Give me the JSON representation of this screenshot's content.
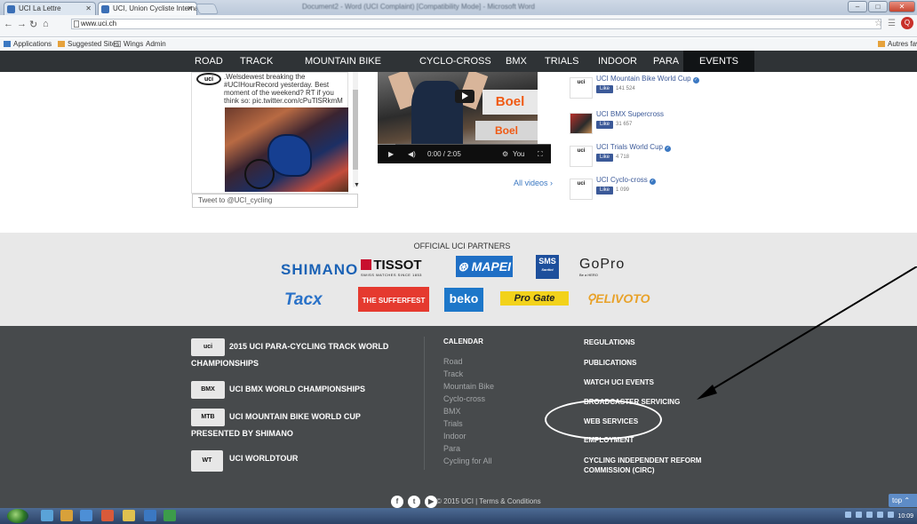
{
  "browser": {
    "tabs": [
      {
        "title": "UCI La Lettre"
      },
      {
        "title": "UCI, Union Cycliste Internationale"
      }
    ],
    "window_title": "Document2 - Word (UCI Complaint) [Compatibility Mode] - Microsoft Word",
    "url": "www.uci.ch",
    "bookmarks": [
      {
        "label": "Applications",
        "color": "#3b78c2"
      },
      {
        "label": "Suggested Sites",
        "color": "#e6a23c"
      },
      {
        "label": "Wings",
        "color": "#888888"
      },
      {
        "label": "Admin",
        "color": "#888888"
      }
    ],
    "autres_favoris": "Autres fav"
  },
  "nav": {
    "items": [
      "ROAD",
      "TRACK",
      "MOUNTAIN BIKE",
      "CYCLO-CROSS",
      "BMX",
      "TRIALS",
      "INDOOR",
      "PARA",
      "EVENTS"
    ],
    "active": "EVENTS"
  },
  "tweet": {
    "logo": "uci",
    "text": ".Welsdewest breaking the #UCIHourRecord yesterday. Best moment of the weekend? RT if you think so: pic.twitter.com/cPuTlSRkmM",
    "input_placeholder": "Tweet to @UCI_cycling"
  },
  "video": {
    "time": "0:00 / 2:05",
    "banner": "Boel",
    "progress": 0.1,
    "all_videos": "All videos ›"
  },
  "channels": [
    {
      "name": "UCI Mountain Bike World Cup",
      "verified": true,
      "count": "141 524",
      "logo": "uci"
    },
    {
      "name": "UCI BMX Supercross",
      "verified": false,
      "count": "31 657",
      "logo": ""
    },
    {
      "name": "UCI Trials World Cup",
      "verified": true,
      "count": "4 718",
      "logo": "uci"
    },
    {
      "name": "UCI Cyclo-cross",
      "verified": true,
      "count": "1 099",
      "logo": "uci"
    }
  ],
  "like_label": "Like",
  "partners": {
    "title": "OFFICIAL UCI PARTNERS",
    "row1": [
      "SHIMANO",
      "TISSOT",
      "MAPEI",
      "SMS",
      "GoPro"
    ],
    "row2": [
      "Tacx",
      "THE SUFFERFEST",
      "beko",
      "Pro Gate",
      "ELIVOTO"
    ],
    "tissot_tagline": "SWISS WATCHES SINCE 1853",
    "sms_caption": "Santini",
    "gopro_caption": "Be a HERO"
  },
  "footer": {
    "championships": [
      {
        "title": "2015 UCI PARA-CYCLING TRACK WORLD CHAMPIONSHIPS",
        "logo": "uci"
      },
      {
        "title": "UCI BMX WORLD CHAMPIONSHIPS",
        "logo": "BMX"
      },
      {
        "title": "UCI MOUNTAIN BIKE WORLD CUP PRESENTED BY SHIMANO",
        "logo": "MTB"
      },
      {
        "title": "UCI WORLDTOUR",
        "logo": "WT"
      }
    ],
    "calendar_title": "CALENDAR",
    "calendar_items": [
      "Road",
      "Track",
      "Mountain Bike",
      "Cyclo-cross",
      "BMX",
      "Trials",
      "Indoor",
      "Para",
      "Cycling for All"
    ],
    "right_links": [
      "REGULATIONS",
      "PUBLICATIONS",
      "WATCH UCI EVENTS",
      "BROADCASTER SERVICING",
      "WEB SERVICES",
      "EMPLOYMENT",
      "CYCLING INDEPENDENT REFORM COMMISSION (CIRC)"
    ],
    "copyright": "© 2015 UCI | Terms & Conditions",
    "top_button": "top"
  },
  "taskbar": {
    "time": "10:09"
  },
  "colors": {
    "nav_bg": "#2f3336",
    "footer_bg": "#474a4c",
    "partners_bg": "#e8e8e8",
    "link_blue": "#3b78c2",
    "facebook_blue": "#3b5998"
  }
}
